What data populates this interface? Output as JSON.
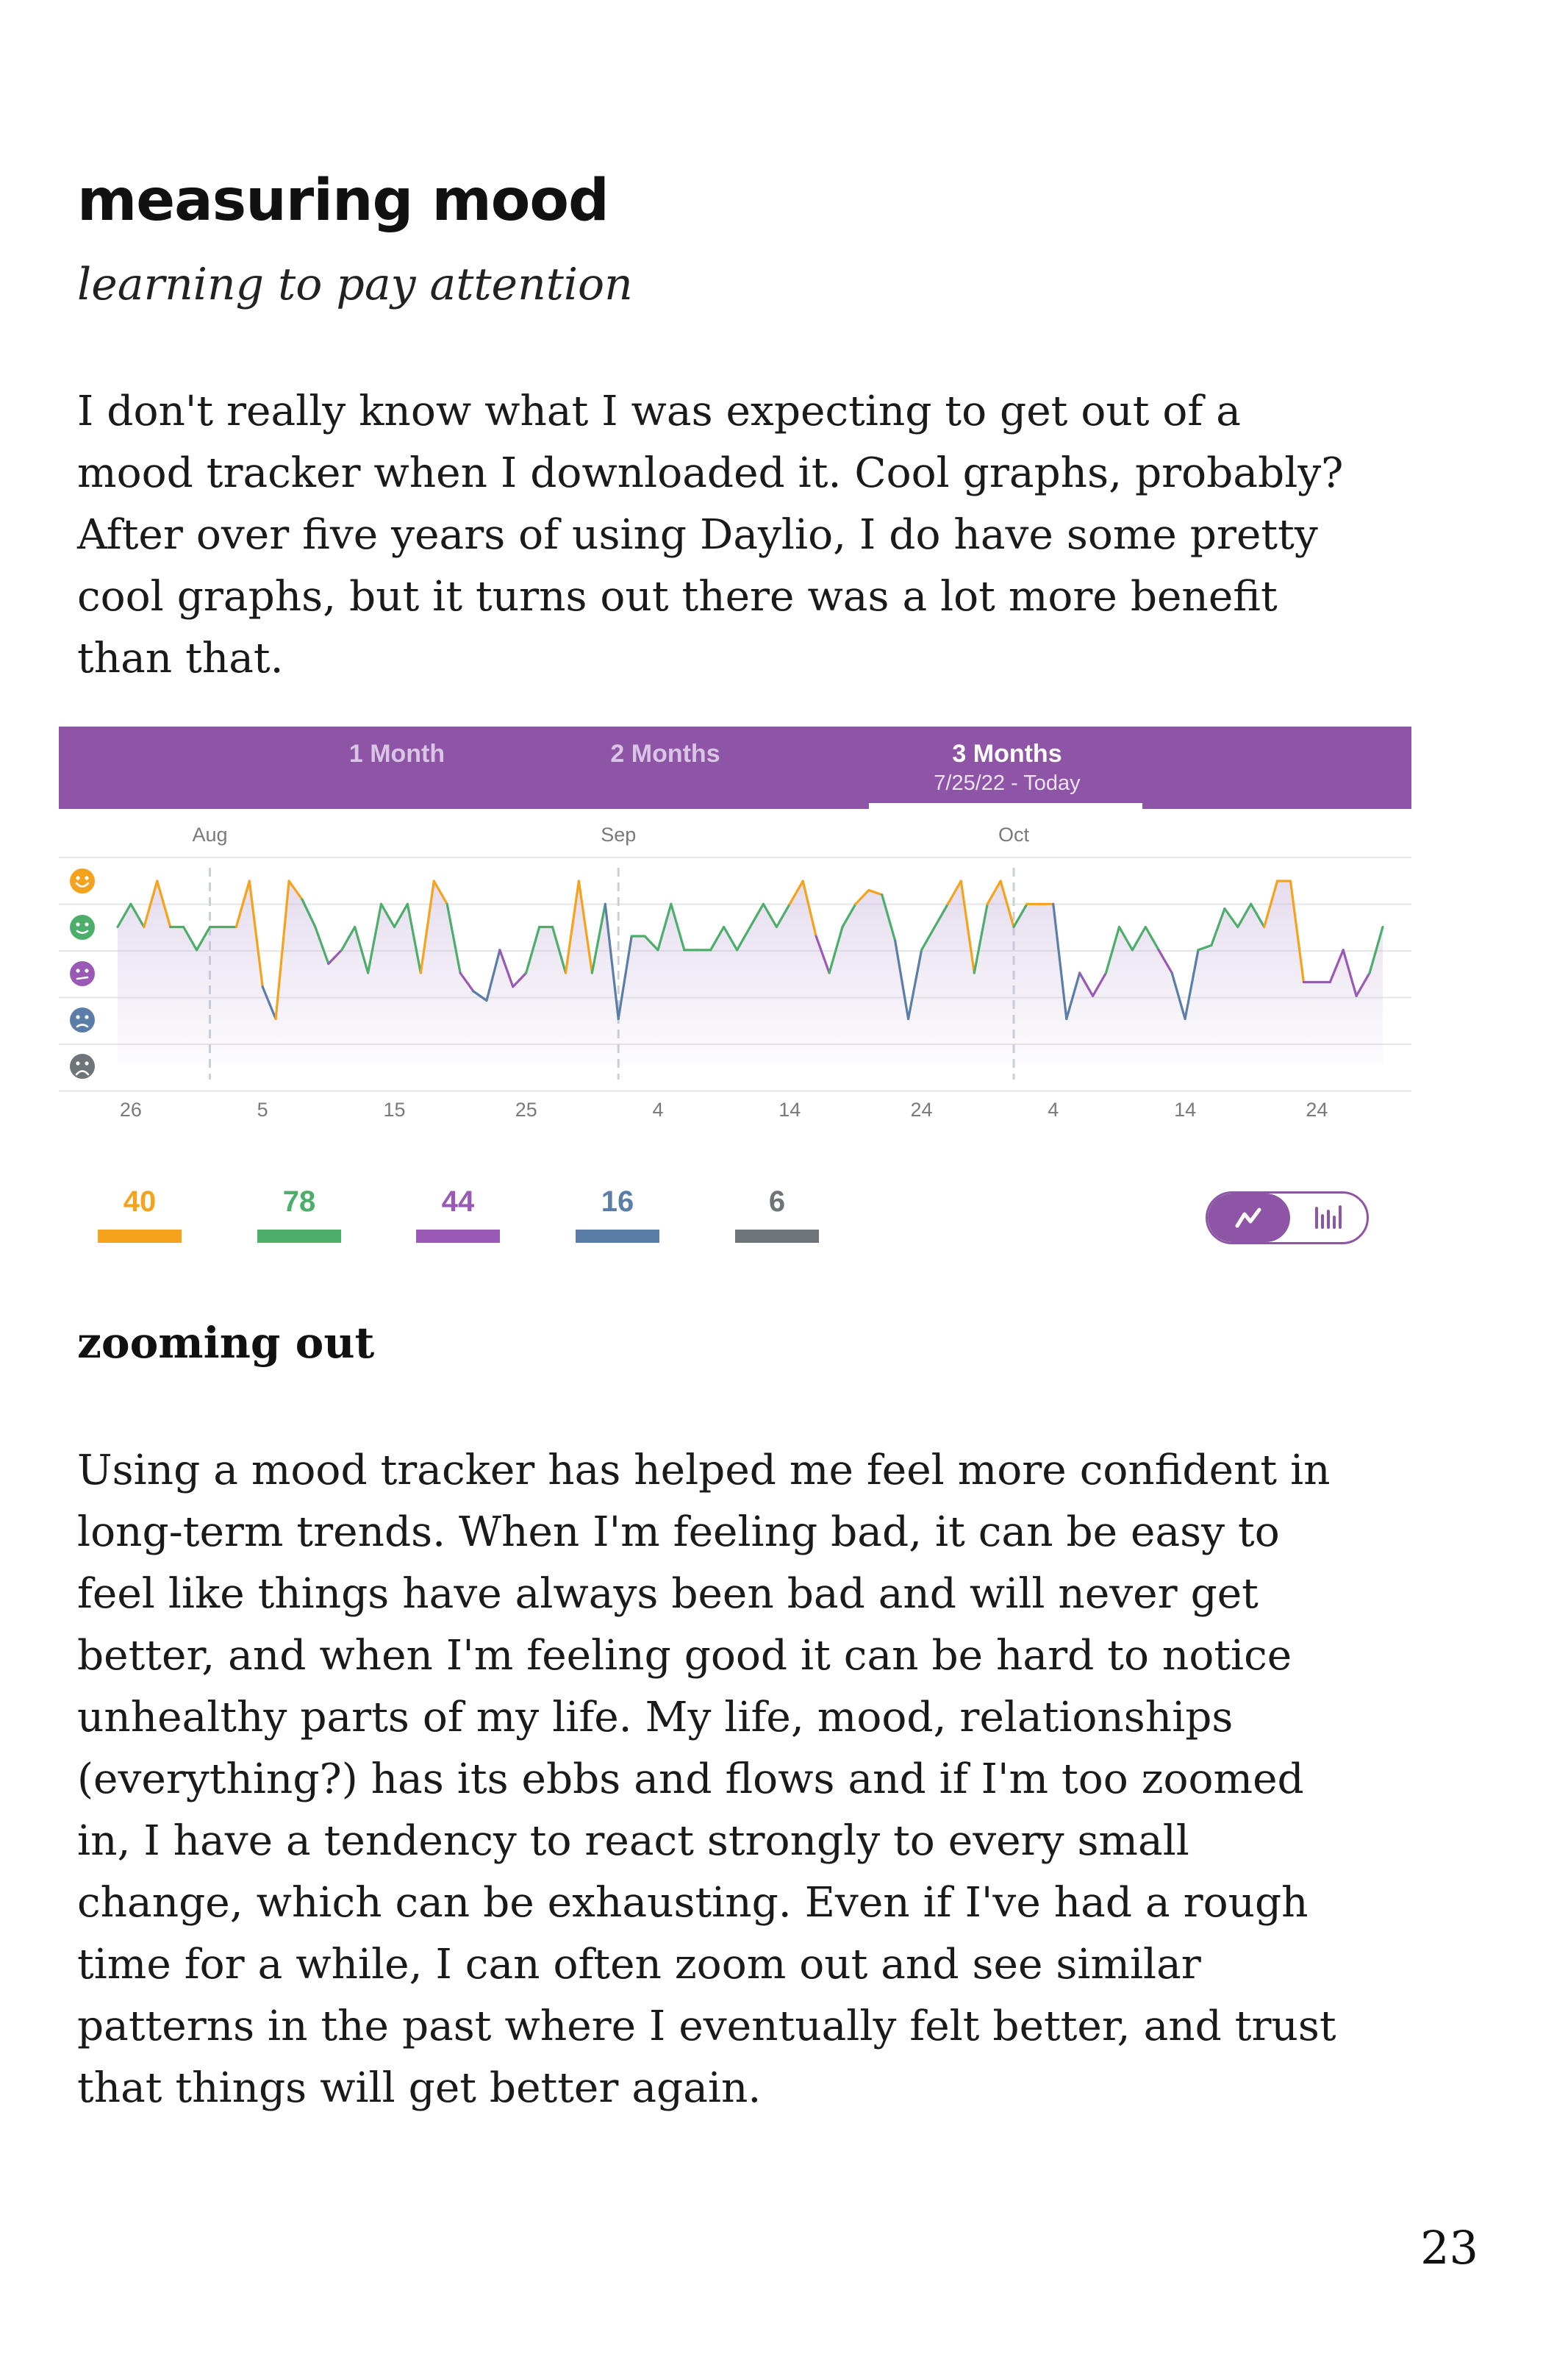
{
  "header": {
    "title": "measuring mood",
    "subtitle": "learning to pay attention"
  },
  "intro": {
    "lines": [
      "I don't really know what I was expecting to get out of a",
      "mood tracker when I downloaded it. Cool graphs, probably?",
      "After over five years of using Daylio, I do have some pretty",
      "cool graphs, but it turns out there was a lot more benefit",
      "than that."
    ]
  },
  "app": {
    "tabs": [
      {
        "label": "1 Month",
        "range": ""
      },
      {
        "label": "2 Months",
        "range": ""
      },
      {
        "label": "3 Months",
        "range": "7/25/22 - Today"
      }
    ],
    "active_tab": "3 Months",
    "colors": {
      "header": "#8e55a6",
      "rad": "#f5a31c",
      "good": "#4cae6a",
      "meh": "#9b59b6",
      "bad": "#5b7ea8",
      "awful": "#6f7478"
    },
    "mood_icons": [
      "rad-face-icon",
      "good-face-icon",
      "meh-face-icon",
      "bad-face-icon",
      "awful-face-icon"
    ],
    "counts": [
      {
        "mood": "rad",
        "value": "40",
        "color": "#f5a31c"
      },
      {
        "mood": "good",
        "value": "78",
        "color": "#4cae6a"
      },
      {
        "mood": "meh",
        "value": "44",
        "color": "#9b59b6"
      },
      {
        "mood": "bad",
        "value": "16",
        "color": "#5b7ea8"
      },
      {
        "mood": "awful",
        "value": "6",
        "color": "#6f7478"
      }
    ],
    "view_toggle": {
      "selected": "line-chart-icon",
      "other": "bar-chart-icon"
    }
  },
  "chart_data": {
    "type": "line",
    "title": "",
    "month_labels": [
      {
        "label": "Aug",
        "day_index": 7
      },
      {
        "label": "Sep",
        "day_index": 38
      },
      {
        "label": "Oct",
        "day_index": 68
      }
    ],
    "x_tick_labels": [
      {
        "label": "26",
        "day_index": 1
      },
      {
        "label": "5",
        "day_index": 11
      },
      {
        "label": "15",
        "day_index": 21
      },
      {
        "label": "25",
        "day_index": 31
      },
      {
        "label": "4",
        "day_index": 41
      },
      {
        "label": "14",
        "day_index": 51
      },
      {
        "label": "24",
        "day_index": 61
      },
      {
        "label": "4",
        "day_index": 71
      },
      {
        "label": "14",
        "day_index": 81
      },
      {
        "label": "24",
        "day_index": 91
      }
    ],
    "y_levels": [
      "rad",
      "good",
      "meh",
      "bad",
      "awful"
    ],
    "ylim": [
      1,
      5
    ],
    "grid": true,
    "series": [
      {
        "values": [
          4,
          4.5,
          4,
          5,
          4,
          4,
          3.5,
          4,
          4,
          4,
          5,
          2.7,
          2,
          5,
          4.6,
          4,
          3.2,
          3.5,
          4,
          3,
          4.5,
          4,
          4.5,
          3,
          5,
          4.5,
          3,
          2.6,
          2.4,
          3.5,
          2.7,
          3,
          4,
          4,
          3,
          5,
          3,
          4.5,
          2,
          3.8,
          3.8,
          3.5,
          4.5,
          3.5,
          3.5,
          3.5,
          4,
          3.5,
          4,
          4.5,
          4,
          4.5,
          5,
          3.8,
          3,
          4,
          4.5,
          4.8,
          4.7,
          3.7,
          2,
          3.5,
          4,
          4.5,
          5,
          3,
          4.5,
          5,
          4,
          4.5,
          4.5,
          4.5,
          2,
          3,
          2.5,
          3,
          4,
          3.5,
          4,
          3.5,
          3,
          2,
          3.5,
          3.6,
          4.4,
          4,
          4.5,
          4,
          5,
          5,
          2.8,
          2.8,
          2.8,
          3.5,
          2.5,
          3,
          4
        ]
      }
    ]
  },
  "section2": {
    "heading": "zooming out",
    "lines": [
      "Using a mood tracker has helped me feel more confident in",
      "long-term trends. When I'm feeling bad, it can be easy to",
      "feel like things have always been bad and will never get",
      "better, and when I'm feeling good it can be hard to notice",
      "unhealthy parts of my life. My life, mood, relationships",
      "(everything?) has its ebbs and flows and if I'm too zoomed",
      "in, I have a tendency to react strongly to every small",
      "change, which can be exhausting. Even if I've had a rough",
      "time for a while, I can often zoom out and see similar",
      "patterns in the past where I eventually felt better, and trust",
      "that things will get better again."
    ]
  },
  "footer": {
    "page_number": "23"
  }
}
